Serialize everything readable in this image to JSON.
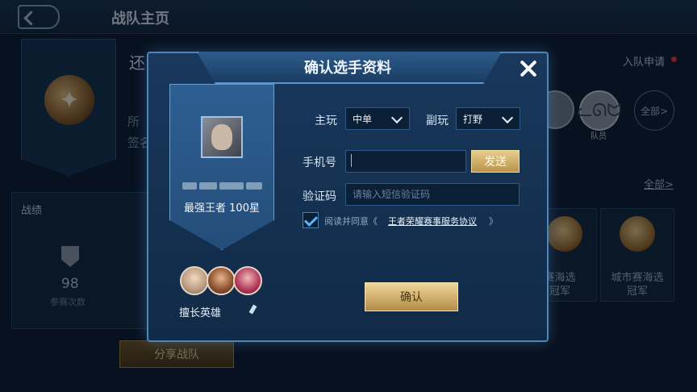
{
  "background": {
    "page_title": "战队主页",
    "team_name_partial": "还",
    "info_line_1": "所",
    "info_line_2": "签名",
    "join_request": "入队申请",
    "member_tag": "队员",
    "all_members": "全部>",
    "all_link": "全部>",
    "stats_title": "战绩",
    "stats_value": "98",
    "stats_label": "参赛次数",
    "trophies": [
      {
        "line1": "赛海选",
        "line2": "冠军"
      },
      {
        "line1": "城市赛海选",
        "line2": "冠军"
      }
    ],
    "share_button": "分享战队"
  },
  "modal": {
    "title": "确认选手资料",
    "player": {
      "rank": "最强王者 100星"
    },
    "hero_label": "擅长英雄",
    "main_role_label": "主玩",
    "main_role_value": "中单",
    "sub_role_label": "副玩",
    "sub_role_value": "打野",
    "phone_label": "手机号",
    "phone_value": "",
    "send_button": "发送",
    "code_label": "验证码",
    "code_placeholder": "请输入短信验证码",
    "agree_prefix": "阅读并同意《",
    "agree_link": "王者荣耀赛事服务协议",
    "agree_suffix": "》",
    "agree_checked": true,
    "confirm_button": "确认"
  },
  "colors": {
    "accent_gold": "#e6cd8c",
    "panel_blue": "#19385c",
    "check_blue": "#59b5ff",
    "notify_red": "#e23a3a"
  }
}
